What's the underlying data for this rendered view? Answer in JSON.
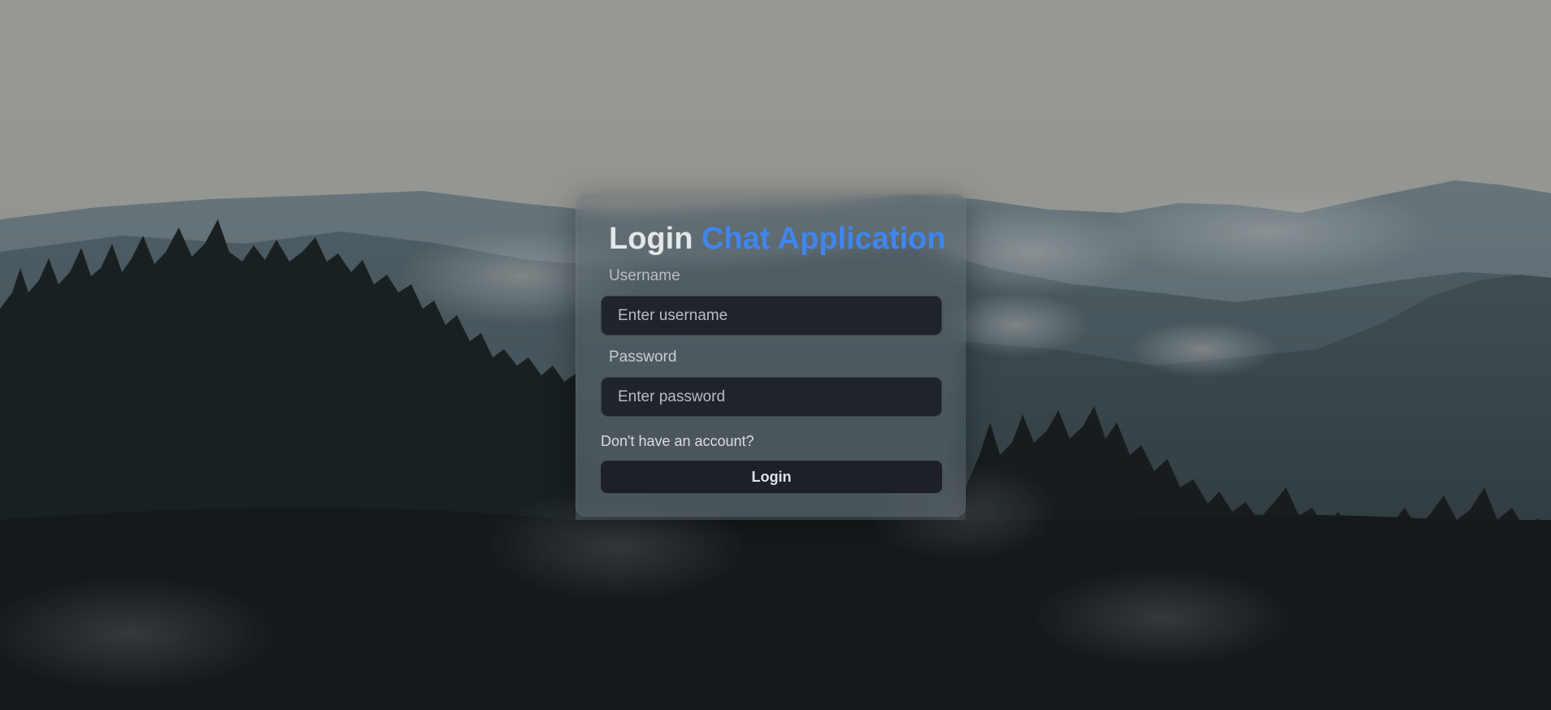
{
  "page": {
    "title_part1": "Login",
    "title_part2": "Chat Application",
    "accent_color": "#3f86ee"
  },
  "form": {
    "username": {
      "label": "Username",
      "placeholder": "Enter username",
      "value": ""
    },
    "password": {
      "label": "Password",
      "placeholder": "Enter password",
      "value": ""
    },
    "signup_link": "Don't have an account?",
    "login_button": "Login"
  },
  "background": {
    "description_icon": "mountain-forest-background"
  }
}
